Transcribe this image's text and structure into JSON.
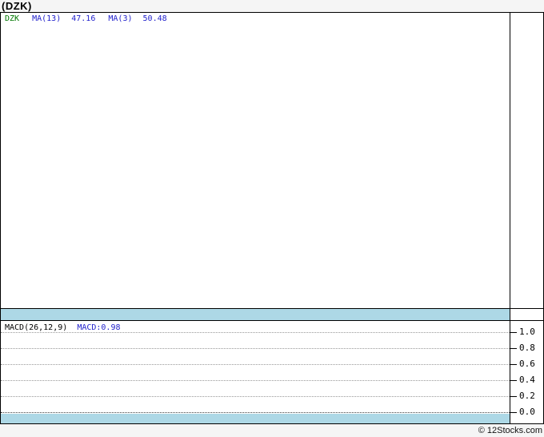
{
  "page": {
    "title": "(DZK)",
    "copyright": "© 12Stocks.com"
  },
  "colors": {
    "page_background": "#F5F5F5",
    "panel_background": "#FFFFFF",
    "panel_border": "#000000",
    "date_band_blue": "#ADD8E6",
    "symbol_green": "#007700",
    "indicator_blue": "#2222CC",
    "gridline_dot": "#999999"
  },
  "main_chart": {
    "legend": {
      "symbol": "DZK",
      "ma13_label": "MA(13)",
      "ma13_value": "47.16",
      "ma3_label": "MA(3)",
      "ma3_value": "50.48"
    }
  },
  "macd": {
    "label": "MACD(26,12,9)",
    "value": "MACD:0.98",
    "ticks": [
      "1.0",
      "0.8",
      "0.6",
      "0.4",
      "0.2",
      "0.0"
    ]
  },
  "chart_data": [
    {
      "type": "line",
      "title": "(DZK)",
      "series": [
        {
          "name": "DZK",
          "color": "#007700",
          "values": []
        },
        {
          "name": "MA(13)",
          "color": "#2222CC",
          "last_value": 47.16,
          "values": []
        },
        {
          "name": "MA(3)",
          "color": "#2222CC",
          "last_value": 50.48,
          "values": []
        }
      ],
      "legend_position": "top-left",
      "axis_position": "right",
      "note": "plot area rendered empty - no price data shown"
    },
    {
      "type": "line",
      "title": "MACD(26,12,9)",
      "series": [
        {
          "name": "MACD",
          "color": "#2222CC",
          "last_value": 0.98,
          "values": []
        }
      ],
      "ylim": [
        0.0,
        1.0
      ],
      "yticks": [
        1.0,
        0.8,
        0.6,
        0.4,
        0.2,
        0.0
      ],
      "grid": "dotted-horizontal",
      "legend_position": "top-left",
      "axis_position": "right",
      "note": "plot area rendered empty - no MACD line shown"
    }
  ]
}
